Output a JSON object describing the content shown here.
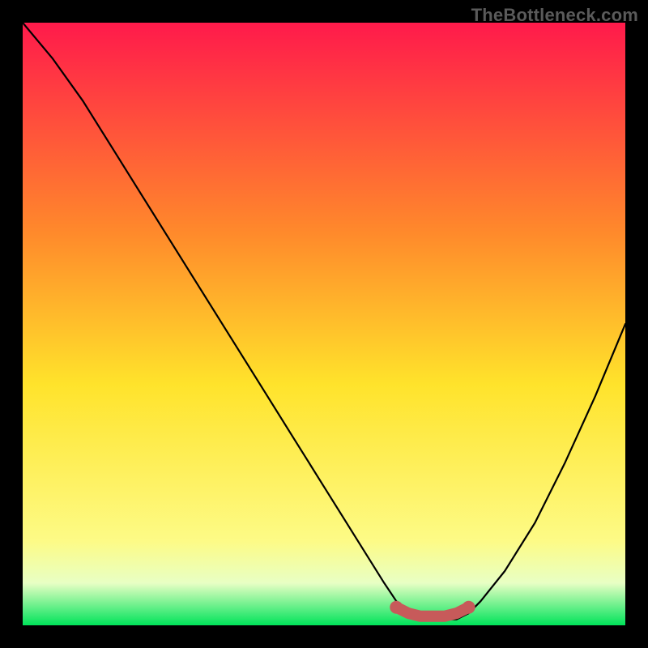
{
  "watermark": "TheBottleneck.com",
  "colors": {
    "bg": "#000000",
    "grad_top": "#ff1a4b",
    "grad_mid1": "#ff8a2b",
    "grad_mid2": "#ffe32b",
    "grad_low": "#fdfb86",
    "grad_pale": "#e8ffc4",
    "grad_green": "#00e35a",
    "curve": "#000000",
    "markers": "#c75a5a",
    "watermark": "#5a5a5a"
  },
  "chart_data": {
    "type": "line",
    "title": "",
    "xlabel": "",
    "ylabel": "",
    "xlim": [
      0,
      100
    ],
    "ylim": [
      0,
      100
    ],
    "series": [
      {
        "name": "bottleneck-curve",
        "x": [
          0,
          5,
          10,
          15,
          20,
          25,
          30,
          35,
          40,
          45,
          50,
          55,
          60,
          62,
          64,
          66,
          68,
          70,
          72,
          74,
          76,
          80,
          85,
          90,
          95,
          100
        ],
        "y": [
          100,
          94,
          87,
          79,
          71,
          63,
          55,
          47,
          39,
          31,
          23,
          15,
          7,
          4,
          2,
          1,
          1,
          1,
          1,
          2,
          4,
          9,
          17,
          27,
          38,
          50
        ]
      }
    ],
    "markers": {
      "name": "optimal-range",
      "x": [
        62,
        64,
        66,
        68,
        70,
        72,
        74
      ],
      "y": [
        3.0,
        2.0,
        1.5,
        1.5,
        1.5,
        2.0,
        3.0
      ]
    },
    "gradient_stops": [
      {
        "offset": 0.0,
        "label": "top"
      },
      {
        "offset": 0.35,
        "label": "orange"
      },
      {
        "offset": 0.6,
        "label": "yellow"
      },
      {
        "offset": 0.86,
        "label": "pale"
      },
      {
        "offset": 0.93,
        "label": "lightgreen"
      },
      {
        "offset": 1.0,
        "label": "green"
      }
    ]
  }
}
